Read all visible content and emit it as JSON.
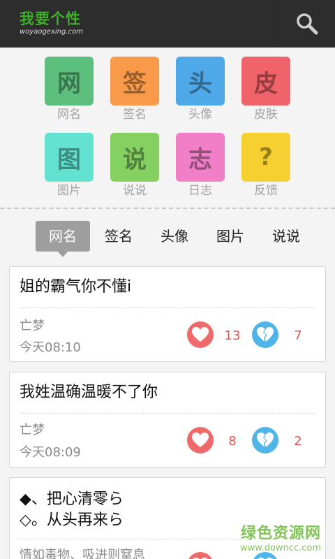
{
  "header": {
    "logo_title": "我要个性",
    "logo_subtitle": "woyaogexing.com",
    "search_icon": "search-icon"
  },
  "categories": [
    {
      "glyph": "网",
      "label": "网名",
      "color": "#5cbf7e"
    },
    {
      "glyph": "签",
      "label": "签名",
      "color": "#f99a4a"
    },
    {
      "glyph": "头",
      "label": "头像",
      "color": "#4fa9e8"
    },
    {
      "glyph": "皮",
      "label": "皮肤",
      "color": "#f0636a"
    },
    {
      "glyph": "图",
      "label": "图片",
      "color": "#63e2d1"
    },
    {
      "glyph": "说",
      "label": "说说",
      "color": "#84d061"
    },
    {
      "glyph": "志",
      "label": "日志",
      "color": "#f07fc8"
    },
    {
      "glyph": "?",
      "label": "反馈",
      "color": "#f5d030"
    }
  ],
  "tabs": [
    {
      "label": "网名",
      "active": true
    },
    {
      "label": "签名",
      "active": false
    },
    {
      "label": "头像",
      "active": false
    },
    {
      "label": "图片",
      "active": false
    },
    {
      "label": "说说",
      "active": false
    }
  ],
  "posts": [
    {
      "text": "姐的霸气你不懂i",
      "author": "亡梦",
      "time": "今天08:10",
      "likes": "13",
      "dislikes": "7"
    },
    {
      "text": "我姓温确温暖不了你",
      "author": "亡梦",
      "time": "今天08:09",
      "likes": "8",
      "dislikes": "2"
    },
    {
      "text": "◆、把心清零ら\n◇。从头再来ら",
      "author": "情如毒物、吸进则窒息",
      "time": "",
      "likes": "",
      "dislikes": ""
    }
  ],
  "watermark": {
    "main": "绿色资源网",
    "url": "www.downcc.com"
  }
}
